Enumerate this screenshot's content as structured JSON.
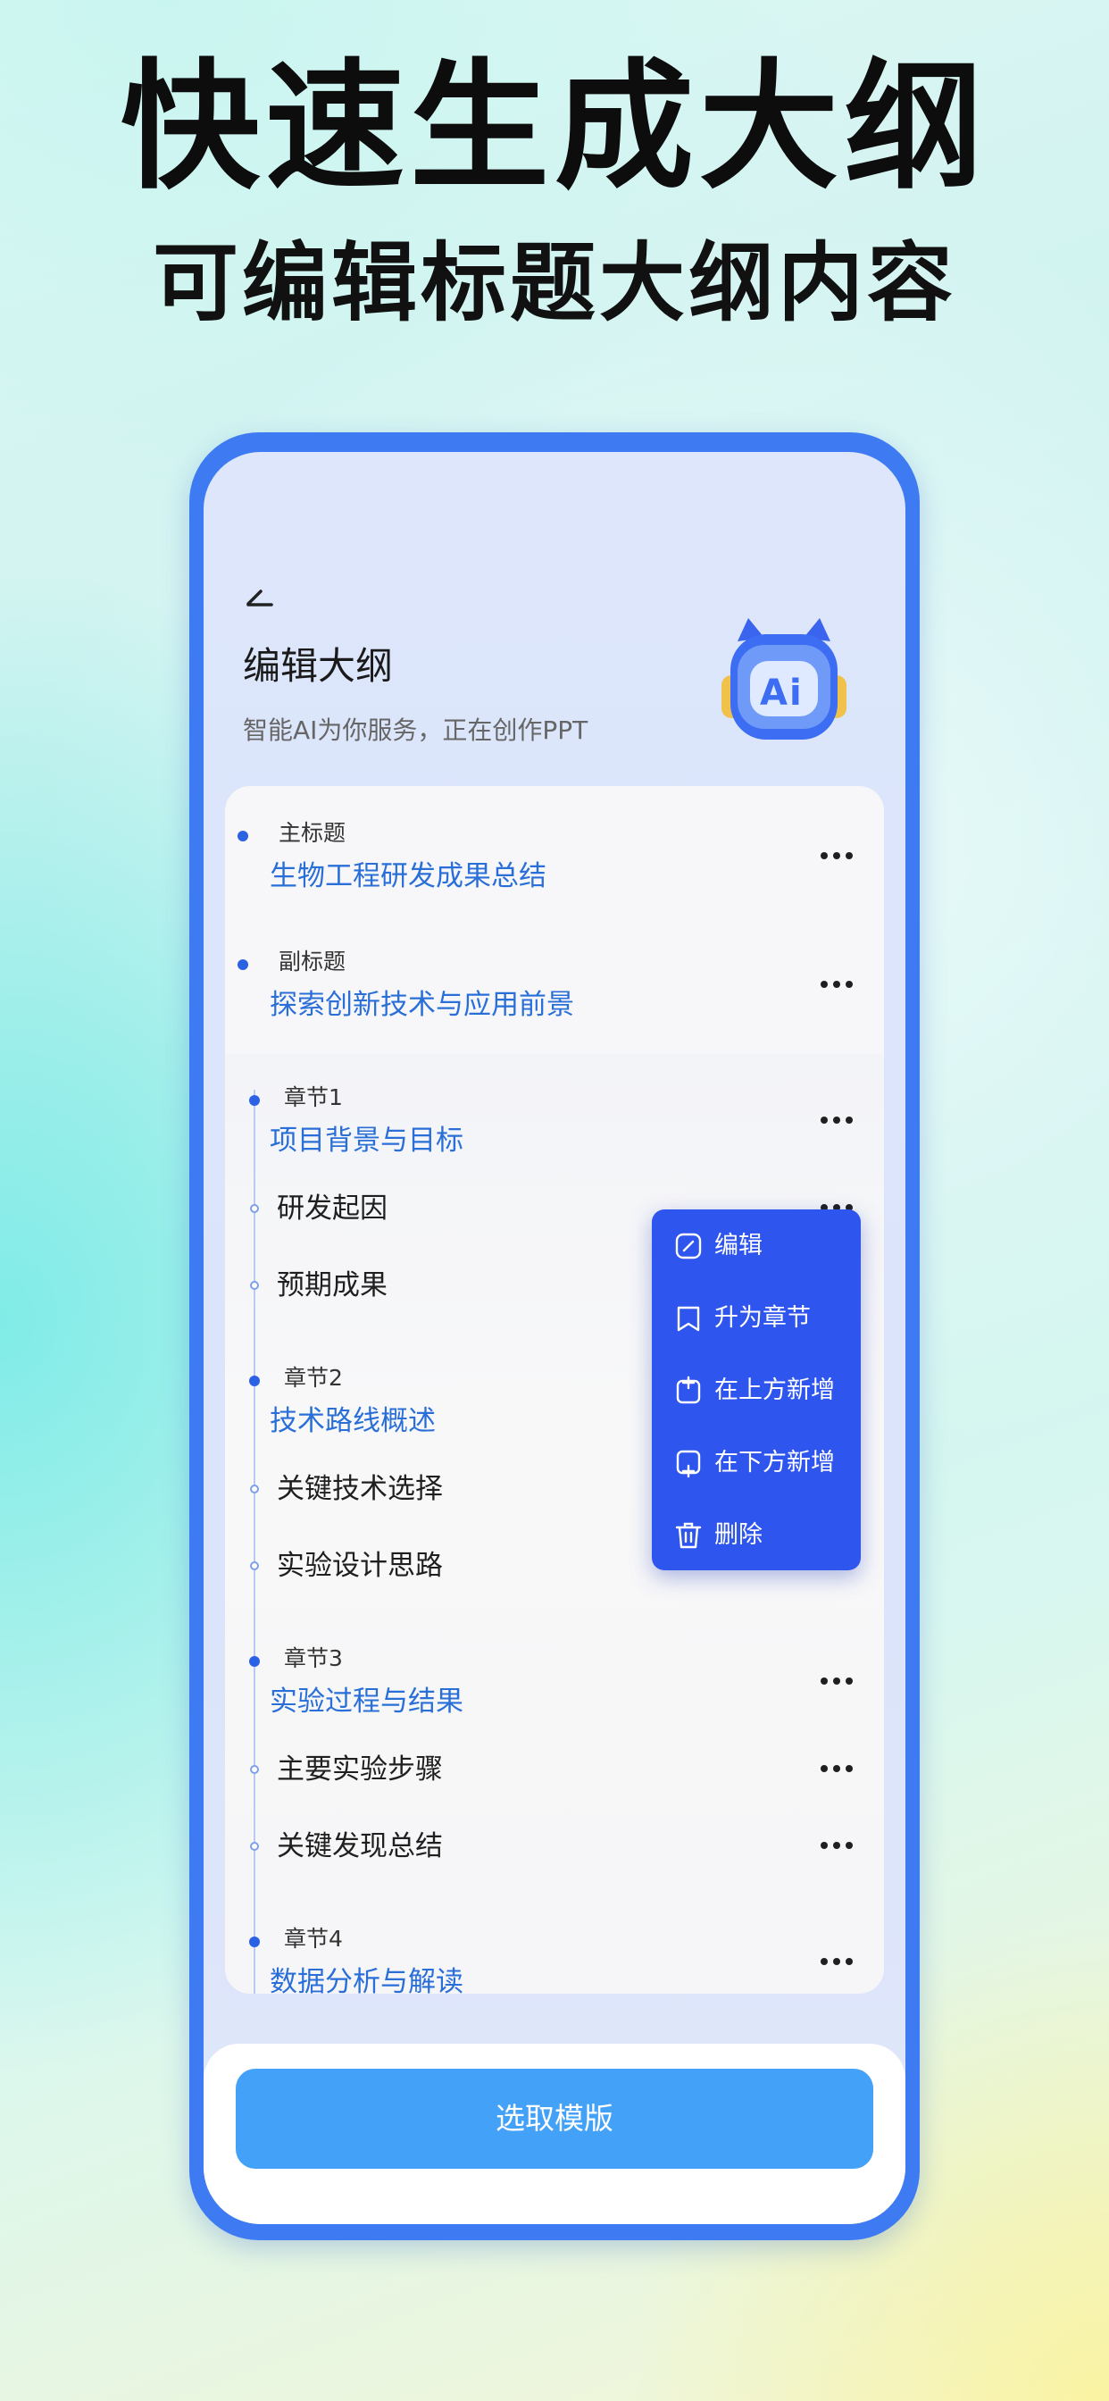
{
  "hero": {
    "title": "快速生成大纲",
    "subtitle": "可编辑标题大纲内容"
  },
  "header": {
    "back_icon": "back-arrow-icon",
    "title": "编辑大纲",
    "subtitle": "智能AI为你服务，正在创作PPT",
    "avatar_icon": "ai-robot-icon"
  },
  "top_items": [
    {
      "label": "主标题",
      "value": "生物工程研发成果总结"
    },
    {
      "label": "副标题",
      "value": "探索创新技术与应用前景"
    }
  ],
  "chapters": [
    {
      "label": "章节1",
      "title": "项目背景与目标",
      "subs": [
        "研发起因",
        "预期成果"
      ]
    },
    {
      "label": "章节2",
      "title": "技术路线概述",
      "subs": [
        "关键技术选择",
        "实验设计思路"
      ]
    },
    {
      "label": "章节3",
      "title": "实验过程与结果",
      "subs": [
        "主要实验步骤",
        "关键发现总结"
      ]
    },
    {
      "label": "章节4",
      "title": "数据分析与解读",
      "subs": []
    }
  ],
  "context_menu": {
    "items": [
      {
        "label": "编辑",
        "icon": "edit-icon"
      },
      {
        "label": "升为章节",
        "icon": "bookmark-icon"
      },
      {
        "label": "在上方新增",
        "icon": "add-above-icon"
      },
      {
        "label": "在下方新增",
        "icon": "add-below-icon"
      },
      {
        "label": "删除",
        "icon": "trash-icon"
      }
    ]
  },
  "more_icon": "more-horizontal-icon",
  "footer": {
    "primary_button": "选取模版"
  },
  "colors": {
    "accent": "#2b62e5",
    "link_text": "#2a6fd8",
    "menu_bg": "#2f55ef",
    "button_bg": "#43a2f7",
    "phone_frame": "#3e7bf2"
  }
}
